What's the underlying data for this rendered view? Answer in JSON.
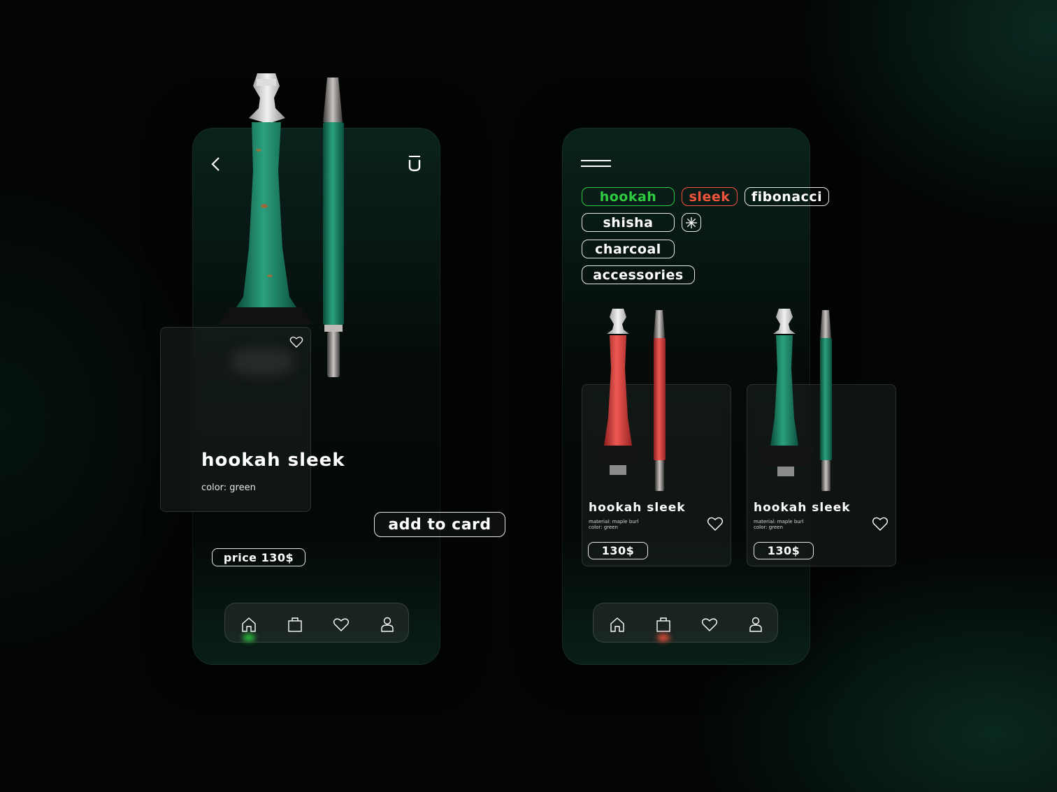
{
  "detail": {
    "product_name": "hookah sleek",
    "color_text": "color: green",
    "add_to_card_label": "add to card",
    "price_label": "price 130$"
  },
  "catalog": {
    "tags": [
      {
        "label": "hookah",
        "color": "#2ecc40"
      },
      {
        "label": "sleek",
        "color": "#f2533a"
      },
      {
        "label": "fibonacci",
        "color": "#ffffff"
      },
      {
        "label": "shisha",
        "color": "#ffffff"
      },
      {
        "label": "charcoal",
        "color": "#ffffff"
      },
      {
        "label": "accessories",
        "color": "#ffffff"
      }
    ],
    "products": [
      {
        "name": "hookah sleek",
        "material": "material: maple burl",
        "color": "color: green",
        "price": "130$"
      },
      {
        "name": "hookah sleek",
        "material": "material: maple burl",
        "color": "color: green",
        "price": "130$"
      }
    ]
  },
  "nav": {
    "items": [
      "home-icon",
      "bag-icon",
      "heart-icon",
      "user-icon"
    ],
    "left_active_color": "#2ecc40",
    "right_active_color": "#f2533a"
  },
  "colors": {
    "green_wood": "#1f8a6a",
    "red_wood": "#d9433d",
    "accent_green": "#2ecc40",
    "accent_red": "#f2533a"
  }
}
